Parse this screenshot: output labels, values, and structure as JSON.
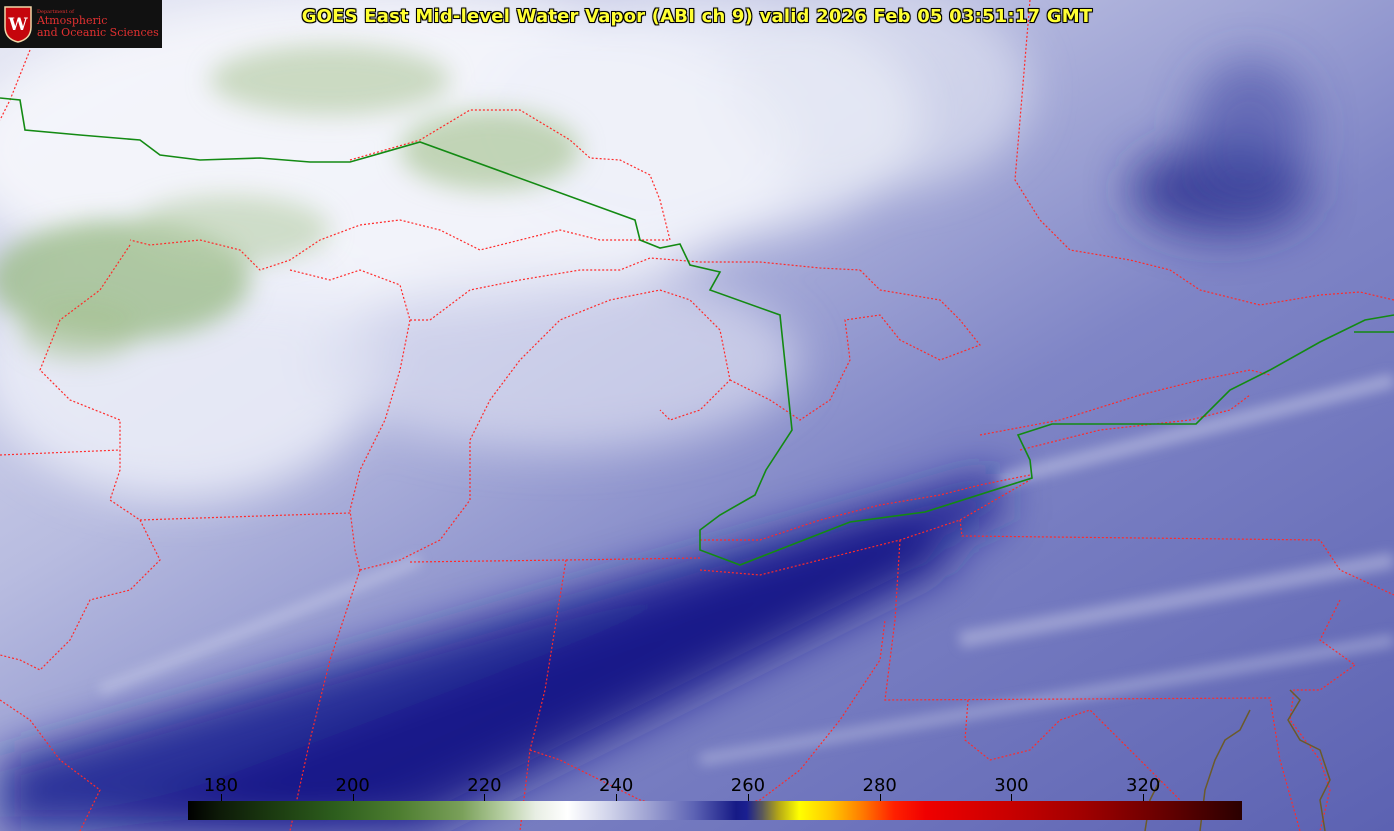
{
  "title": "GOES East Mid-level Water Vapor (ABI ch 9)  valid 2026 Feb 05 03:51:17 GMT",
  "logo": {
    "department": "Department of",
    "line1": "Atmospheric",
    "line2": "and Oceanic Sciences",
    "badge_letter": "W"
  },
  "colorbar": {
    "ticks": [
      "180",
      "200",
      "220",
      "240",
      "260",
      "280",
      "300",
      "320"
    ],
    "range_min": 175,
    "range_max": 335
  },
  "colors": {
    "title": "#ffff33",
    "state_borders": "#ff3030",
    "international_border": "#138a13",
    "coast_outline": "#6b5a2a"
  }
}
